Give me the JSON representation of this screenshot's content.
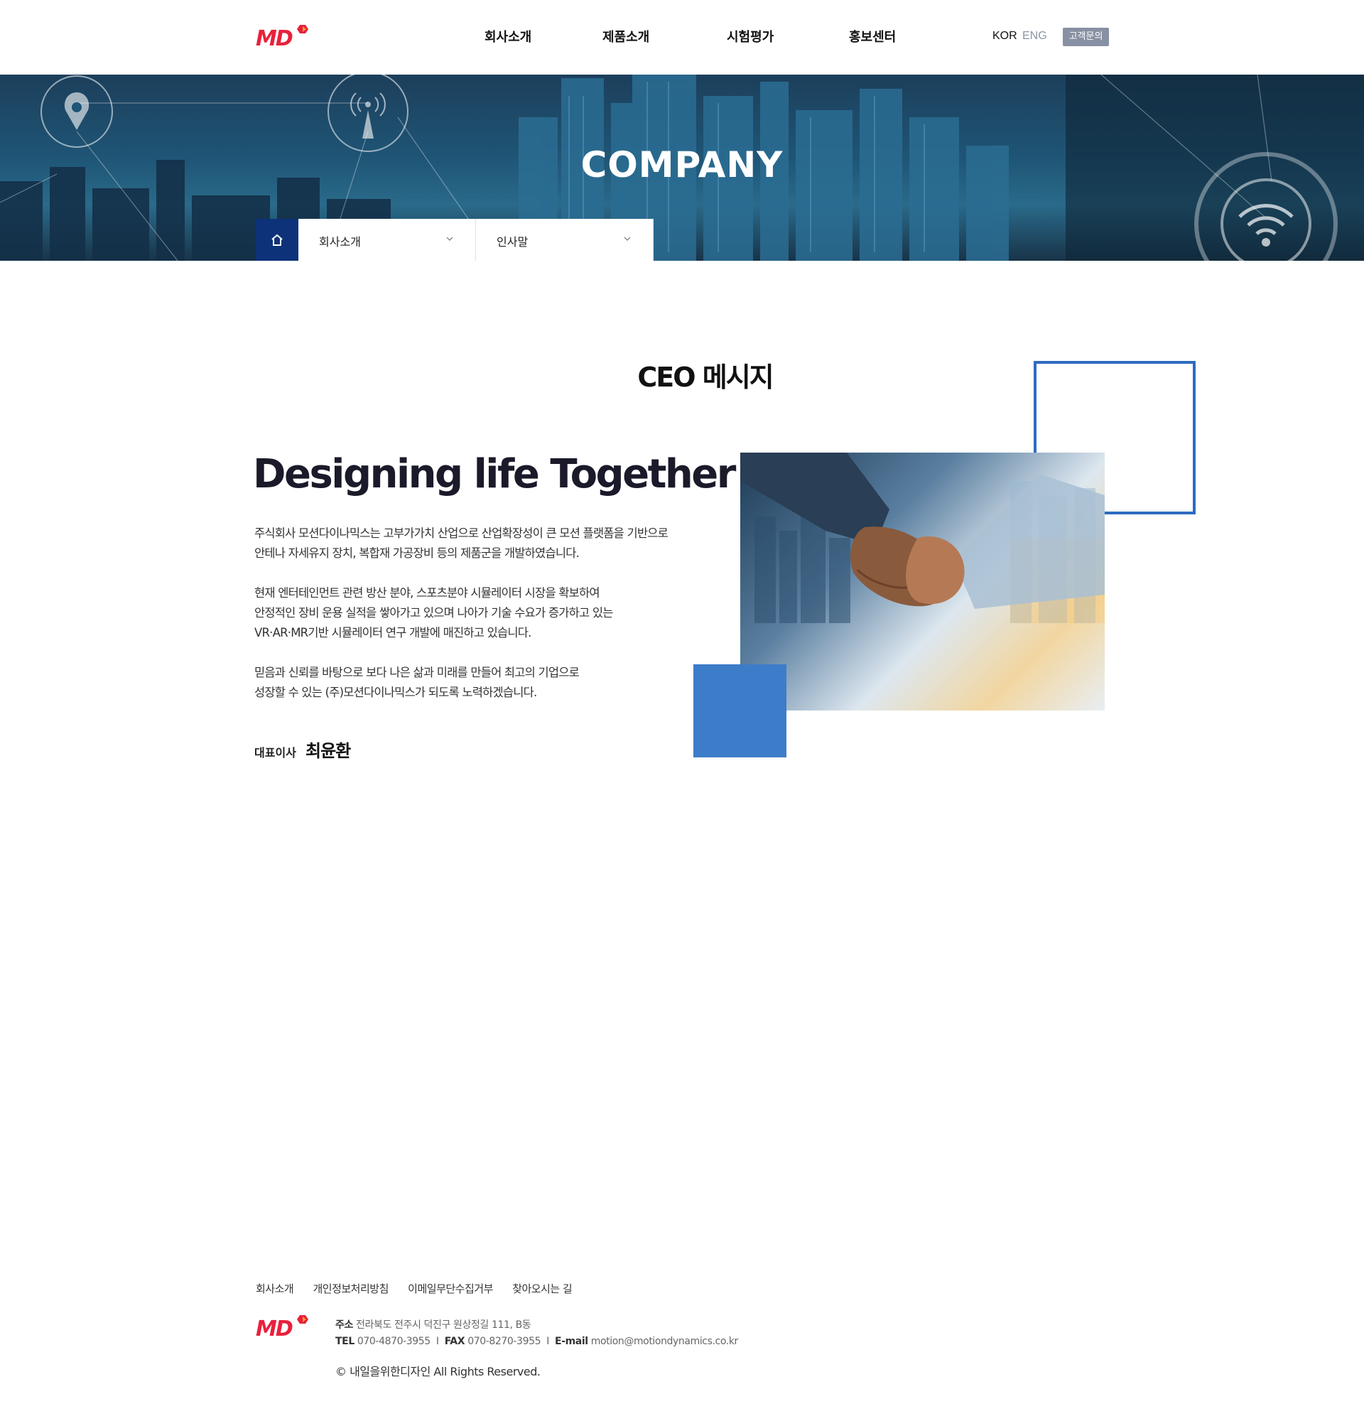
{
  "header": {
    "logo_text": "MD",
    "nav": [
      "회사소개",
      "제품소개",
      "시험평가",
      "홍보센터"
    ],
    "lang_kor": "KOR",
    "lang_eng": "ENG",
    "inquiry_label": "고객문의"
  },
  "hero": {
    "title": "COMPANY"
  },
  "subnav": {
    "home_icon": "home-icon",
    "menu1_label": "회사소개",
    "menu2_label": "인사말"
  },
  "content": {
    "section_title": "CEO 메시지",
    "headline": "Designing life Together",
    "p1_line1": "주식회사 모션다이나믹스는 고부가가치 산업으로 산업확장성이 큰 모션 플랫폼을 기반으로",
    "p1_line2": "안테나 자세유지 장치, 복합재 가공장비 등의 제품군을 개발하였습니다.",
    "p2_line1": "현재 엔터테인먼트 관련 방산 분야, 스포츠분야 시뮬레이터 시장을 확보하여",
    "p2_line2": "안정적인 장비 운용 실적을 쌓아가고 있으며 나아가 기술 수요가 증가하고 있는",
    "p2_line3": "VR·AR·MR기반 시뮬레이터 연구 개발에 매진하고 있습니다.",
    "p3_line1": "믿음과 신뢰를 바탕으로 보다 나은 삶과 미래를 만들어 최고의 기업으로",
    "p3_line2": "성장할 수 있는 (주)모션다이나믹스가 되도록 노력하겠습니다.",
    "ceo_role": "대표이사",
    "ceo_name": "최윤환"
  },
  "footer": {
    "links": [
      "회사소개",
      "개인정보처리방침",
      "이메일무단수집거부",
      "찾아오시는 길"
    ],
    "address_label": "주소",
    "address": "전라북도 전주시 덕진구 원상정길 111, B동",
    "tel_label": "TEL",
    "tel": "070-4870-3955",
    "fax_label": "FAX",
    "fax": "070-8270-3955",
    "email_label": "E-mail",
    "email": "motion@motiondynamics.co.kr",
    "copyright": "© 내일을위한디자인  All Rights Reserved."
  },
  "colors": {
    "brand_red": "#e8213c",
    "navy": "#0d3279",
    "accent_blue": "#2e6bc1",
    "square_blue": "#3d7cc8"
  }
}
